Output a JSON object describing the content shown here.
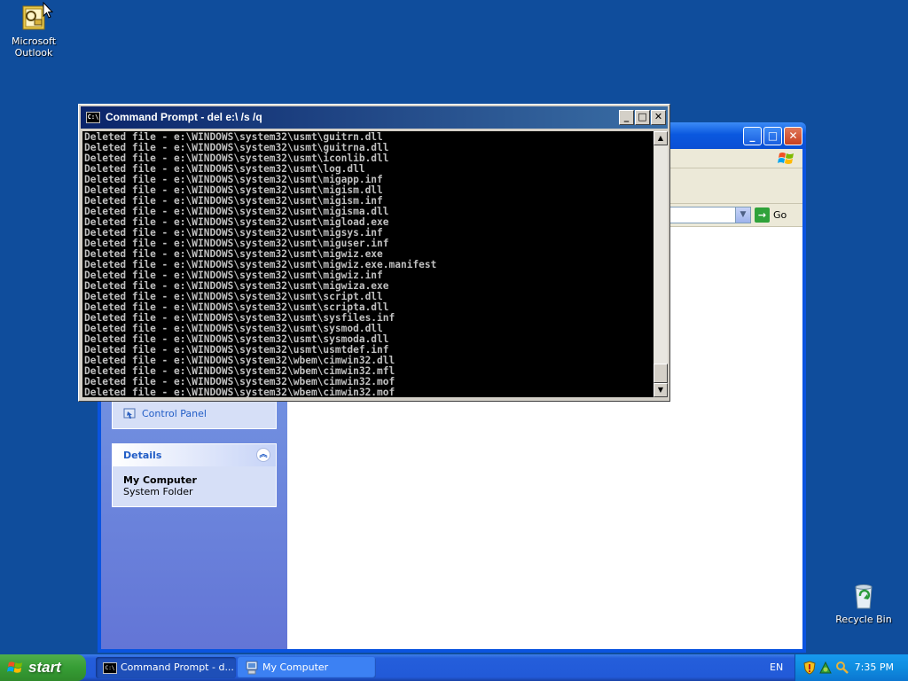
{
  "desktop": {
    "icons": [
      {
        "label": "Microsoft Outlook"
      },
      {
        "label": "Recycle Bin"
      }
    ]
  },
  "explorer": {
    "window_title": "My Computer",
    "go_label": "Go",
    "task_link": "Control Panel",
    "details": {
      "header": "Details",
      "title": "My Computer",
      "subtitle": "System Folder"
    }
  },
  "cmd": {
    "title": "Command Prompt - del e:\\ /s /q",
    "lines": [
      "Deleted file - e:\\WINDOWS\\system32\\usmt\\guitrn.dll",
      "Deleted file - e:\\WINDOWS\\system32\\usmt\\guitrna.dll",
      "Deleted file - e:\\WINDOWS\\system32\\usmt\\iconlib.dll",
      "Deleted file - e:\\WINDOWS\\system32\\usmt\\log.dll",
      "Deleted file - e:\\WINDOWS\\system32\\usmt\\migapp.inf",
      "Deleted file - e:\\WINDOWS\\system32\\usmt\\migism.dll",
      "Deleted file - e:\\WINDOWS\\system32\\usmt\\migism.inf",
      "Deleted file - e:\\WINDOWS\\system32\\usmt\\migisma.dll",
      "Deleted file - e:\\WINDOWS\\system32\\usmt\\migload.exe",
      "Deleted file - e:\\WINDOWS\\system32\\usmt\\migsys.inf",
      "Deleted file - e:\\WINDOWS\\system32\\usmt\\miguser.inf",
      "Deleted file - e:\\WINDOWS\\system32\\usmt\\migwiz.exe",
      "Deleted file - e:\\WINDOWS\\system32\\usmt\\migwiz.exe.manifest",
      "Deleted file - e:\\WINDOWS\\system32\\usmt\\migwiz.inf",
      "Deleted file - e:\\WINDOWS\\system32\\usmt\\migwiza.exe",
      "Deleted file - e:\\WINDOWS\\system32\\usmt\\script.dll",
      "Deleted file - e:\\WINDOWS\\system32\\usmt\\scripta.dll",
      "Deleted file - e:\\WINDOWS\\system32\\usmt\\sysfiles.inf",
      "Deleted file - e:\\WINDOWS\\system32\\usmt\\sysmod.dll",
      "Deleted file - e:\\WINDOWS\\system32\\usmt\\sysmoda.dll",
      "Deleted file - e:\\WINDOWS\\system32\\usmt\\usmtdef.inf",
      "Deleted file - e:\\WINDOWS\\system32\\wbem\\cimwin32.dll",
      "Deleted file - e:\\WINDOWS\\system32\\wbem\\cimwin32.mfl",
      "Deleted file - e:\\WINDOWS\\system32\\wbem\\cimwin32.mof",
      "Deleted file - e:\\WINDOWS\\system32\\wbem\\cimwin32.mof"
    ]
  },
  "taskbar": {
    "start_label": "start",
    "items": [
      {
        "label": "Command Prompt - d...",
        "icon": "cmd-icon"
      },
      {
        "label": "My Computer",
        "icon": "computer-icon"
      }
    ],
    "language": "EN",
    "clock": "7:35 PM"
  },
  "colors": {
    "desktop": "#0f4d9c",
    "console_bg": "#000000",
    "console_text": "#c0c0c0",
    "start_green": "#369d35"
  }
}
